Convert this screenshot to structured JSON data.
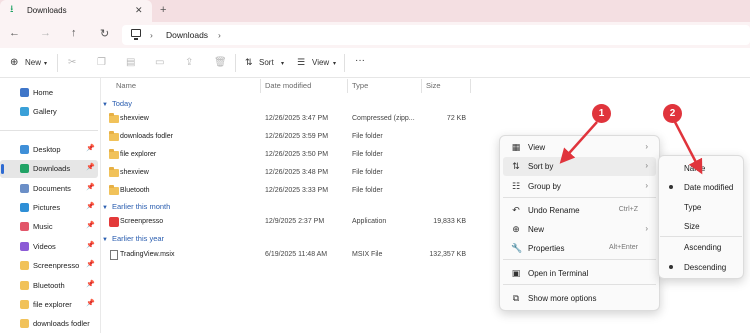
{
  "window": {
    "tab_title": "Downloads",
    "tab_close": "✕",
    "new_tab": "+",
    "back": "←",
    "forward": "→",
    "up": "↑",
    "refresh": "↻",
    "breadcrumb_sep": "›",
    "breadcrumb": "Downloads"
  },
  "toolbar": {
    "new_label": "New",
    "sort_label": "Sort",
    "view_label": "View",
    "more": "···"
  },
  "sidebar": {
    "items": [
      {
        "label": "Home",
        "icon": "home-icon",
        "color": "#3f76c9"
      },
      {
        "label": "Gallery",
        "icon": "gallery-icon",
        "color": "#3aa0d8"
      },
      {
        "label": "Desktop",
        "icon": "desktop-icon",
        "color": "#3f8fd8"
      },
      {
        "label": "Downloads",
        "icon": "download-icon",
        "color": "#21a366"
      },
      {
        "label": "Documents",
        "icon": "documents-icon",
        "color": "#6b8fc7"
      },
      {
        "label": "Pictures",
        "icon": "pictures-icon",
        "color": "#2f8fd6"
      },
      {
        "label": "Music",
        "icon": "music-icon",
        "color": "#e2566a"
      },
      {
        "label": "Videos",
        "icon": "videos-icon",
        "color": "#8c5bd6"
      },
      {
        "label": "Screenpresso",
        "icon": "folder-icon",
        "color": "#f1c25a"
      },
      {
        "label": "Bluetooth",
        "icon": "folder-icon",
        "color": "#f1c25a"
      },
      {
        "label": "file explorer",
        "icon": "folder-icon",
        "color": "#f1c25a"
      },
      {
        "label": "downloads fodler",
        "icon": "folder-icon",
        "color": "#f1c25a"
      }
    ],
    "pin": "✎"
  },
  "columns": {
    "name": "Name",
    "date": "Date modified",
    "type": "Type",
    "size": "Size"
  },
  "groups": {
    "today": "Today",
    "month": "Earlier this month",
    "year": "Earlier this year"
  },
  "files": [
    {
      "name": "shexview",
      "date": "12/26/2025 3:47 PM",
      "type": "Compressed (zipp...",
      "size": "72 KB"
    },
    {
      "name": "downloads fodler",
      "date": "12/26/2025 3:59 PM",
      "type": "File folder",
      "size": ""
    },
    {
      "name": "file explorer",
      "date": "12/26/2025 3:50 PM",
      "type": "File folder",
      "size": ""
    },
    {
      "name": "shexview",
      "date": "12/26/2025 3:48 PM",
      "type": "File folder",
      "size": ""
    },
    {
      "name": "Bluetooth",
      "date": "12/26/2025 3:33 PM",
      "type": "File folder",
      "size": ""
    },
    {
      "name": "Screenpresso",
      "date": "12/9/2025 2:37 PM",
      "type": "Application",
      "size": "19,833 KB"
    },
    {
      "name": "TradingView.msix",
      "date": "6/19/2025 11:48 AM",
      "type": "MSIX File",
      "size": "132,357 KB"
    }
  ],
  "context_menu": {
    "view": "View",
    "sort_by": "Sort by",
    "group_by": "Group by",
    "undo_rename": "Undo Rename",
    "undo_shortcut": "Ctrl+Z",
    "new": "New",
    "properties": "Properties",
    "properties_shortcut": "Alt+Enter",
    "open_terminal": "Open in Terminal",
    "show_more": "Show more options",
    "arrow": "›"
  },
  "sort_menu": {
    "name": "Name",
    "date_modified": "Date modified",
    "type": "Type",
    "size": "Size",
    "ascending": "Ascending",
    "descending": "Descending"
  },
  "annotations": {
    "badge1": "1",
    "badge2": "2",
    "color": "#e0343c"
  }
}
